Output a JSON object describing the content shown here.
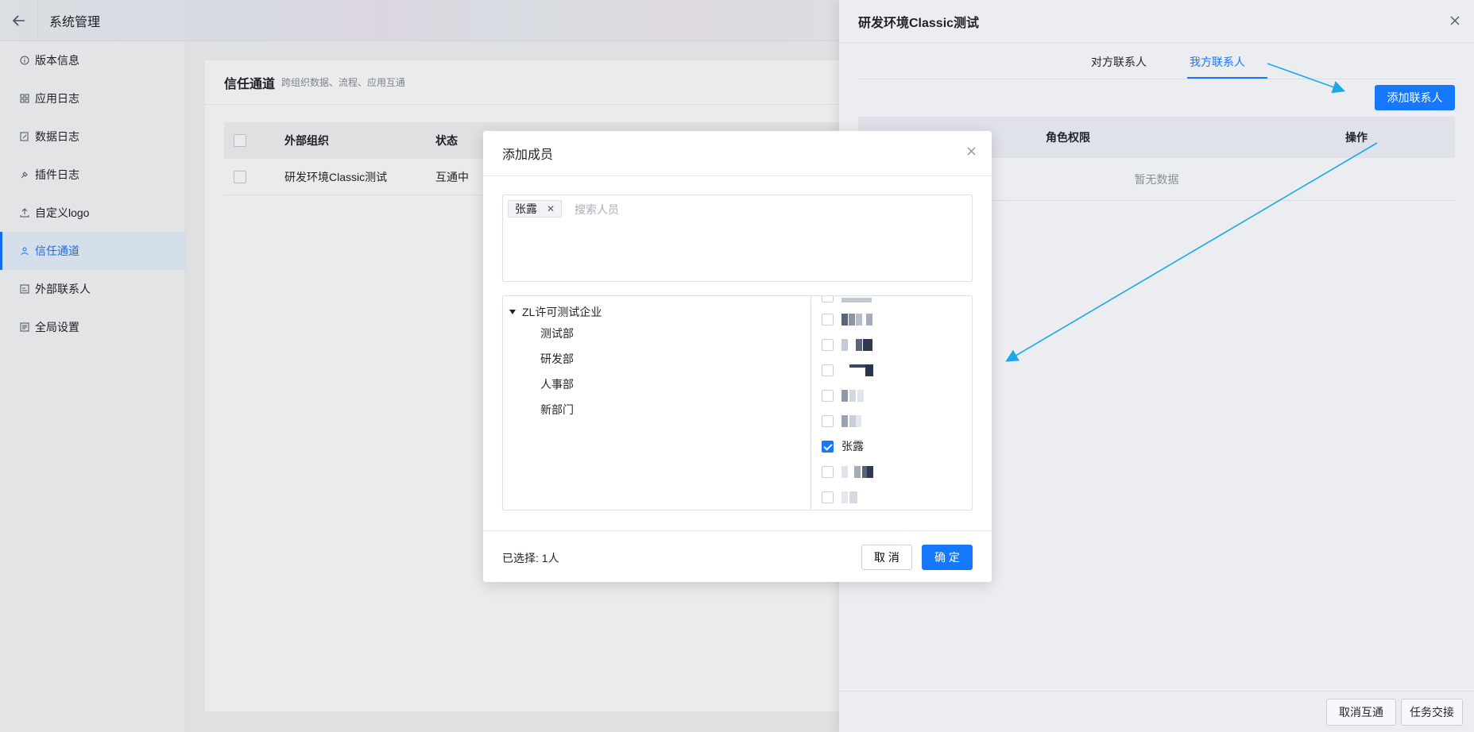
{
  "topbar": {
    "title": "系统管理"
  },
  "sidebar": {
    "items": [
      {
        "label": "版本信息",
        "icon": "info-icon"
      },
      {
        "label": "应用日志",
        "icon": "grid-icon"
      },
      {
        "label": "数据日志",
        "icon": "edit-doc-icon"
      },
      {
        "label": "插件日志",
        "icon": "plugin-icon"
      },
      {
        "label": "自定义logo",
        "icon": "upload-icon"
      },
      {
        "label": "信任通道",
        "icon": "people-icon",
        "active": true
      },
      {
        "label": "外部联系人",
        "icon": "contact-card-icon"
      },
      {
        "label": "全局设置",
        "icon": "settings-doc-icon"
      }
    ]
  },
  "main": {
    "title": "信任通道",
    "subtitle": "跨组织数据、流程、应用互通",
    "table": {
      "headers": [
        "外部组织",
        "状态"
      ],
      "rows": [
        {
          "org": "研发环境Classic测试",
          "status": "互通中"
        }
      ]
    }
  },
  "drawer": {
    "title": "研发环境Classic测试",
    "tabs": [
      "对方联系人",
      "我方联系人"
    ],
    "active_tab": "我方联系人",
    "add_button": "添加联系人",
    "table_headers": {
      "role": "角色权限",
      "operation": "操作"
    },
    "empty_text": "暂无数据",
    "footer": {
      "cancel_interop": "取消互通",
      "handover": "任务交接"
    }
  },
  "modal": {
    "title": "添加成员",
    "selected_tag": "张露",
    "search_placeholder": "搜索人员",
    "tree": {
      "root": "ZL许可测试企业",
      "children": [
        "测试部",
        "研发部",
        "人事部",
        "新部门"
      ]
    },
    "members": [
      {
        "name": "",
        "checked": false,
        "blurred": true
      },
      {
        "name": "",
        "checked": false,
        "blurred": true
      },
      {
        "name": "",
        "checked": false,
        "blurred": true
      },
      {
        "name": "",
        "checked": false,
        "blurred": true
      },
      {
        "name": "",
        "checked": false,
        "blurred": true
      },
      {
        "name": "张露",
        "checked": true,
        "blurred": false
      },
      {
        "name": "",
        "checked": false,
        "blurred": true
      },
      {
        "name": "",
        "checked": false,
        "blurred": true
      }
    ],
    "selected_count": "已选择: 1人",
    "cancel": "取 消",
    "confirm": "确 定"
  },
  "colors": {
    "accent": "#1677ff",
    "annotation_arrow": "#1aa9e8"
  }
}
